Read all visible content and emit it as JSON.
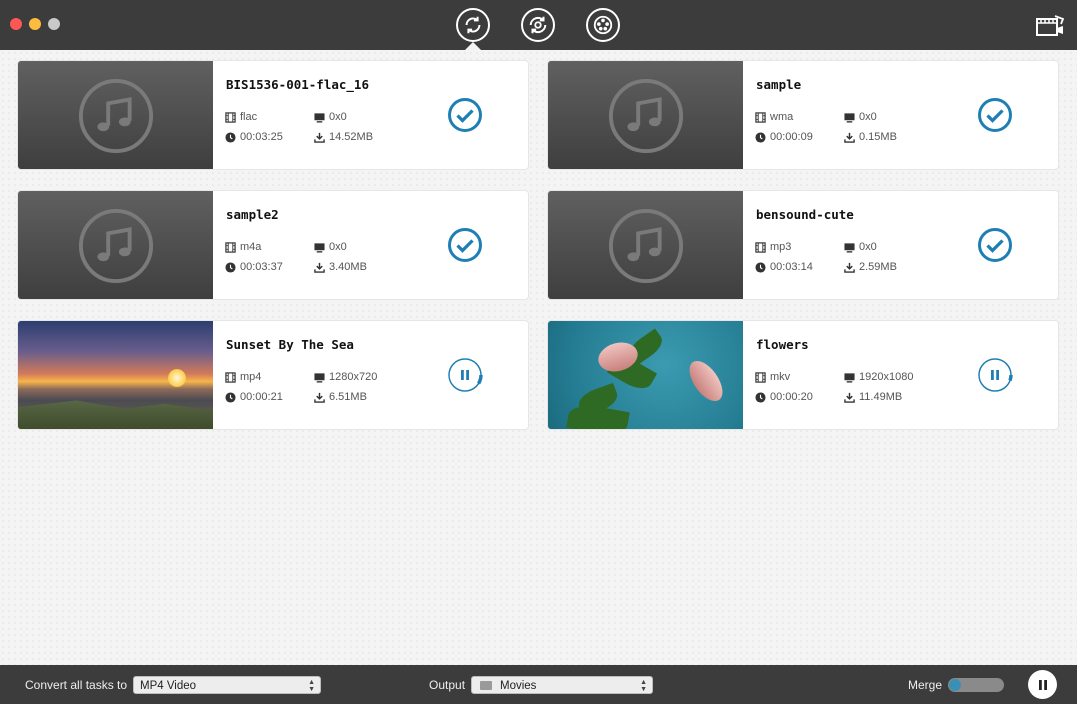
{
  "toolbar": {
    "tools": [
      {
        "name": "convert-tool",
        "icon": "convert-icon",
        "active": true
      },
      {
        "name": "sync-tool",
        "icon": "sync-icon",
        "active": false
      },
      {
        "name": "film-tool",
        "icon": "film-reel-icon",
        "active": false
      }
    ],
    "media_icon": "media-browser-icon"
  },
  "tasks": [
    {
      "name": "BIS1536-001-flac_16",
      "format": "flac",
      "resolution": "0x0",
      "duration": "00:03:25",
      "size": "14.52MB",
      "status": "done",
      "thumb": "music"
    },
    {
      "name": "sample",
      "format": "wma",
      "resolution": "0x0",
      "duration": "00:00:09",
      "size": "0.15MB",
      "status": "done",
      "thumb": "music"
    },
    {
      "name": "sample2",
      "format": "m4a",
      "resolution": "0x0",
      "duration": "00:03:37",
      "size": "3.40MB",
      "status": "done",
      "thumb": "music"
    },
    {
      "name": "bensound-cute",
      "format": "mp3",
      "resolution": "0x0",
      "duration": "00:03:14",
      "size": "2.59MB",
      "status": "done",
      "thumb": "music"
    },
    {
      "name": "Sunset By The Sea",
      "format": "mp4",
      "resolution": "1280x720",
      "duration": "00:00:21",
      "size": "6.51MB",
      "status": "converting",
      "thumb": "sunset"
    },
    {
      "name": "flowers",
      "format": "mkv",
      "resolution": "1920x1080",
      "duration": "00:00:20",
      "size": "11.49MB",
      "status": "converting",
      "thumb": "flowers"
    }
  ],
  "bottom": {
    "convert_label": "Convert all tasks to",
    "format_value": "MP4 Video",
    "output_label": "Output",
    "output_value": "Movies",
    "merge_label": "Merge",
    "merge_on": false
  },
  "colors": {
    "accent": "#1f7fb5",
    "titlebar": "#3c3c3c"
  }
}
